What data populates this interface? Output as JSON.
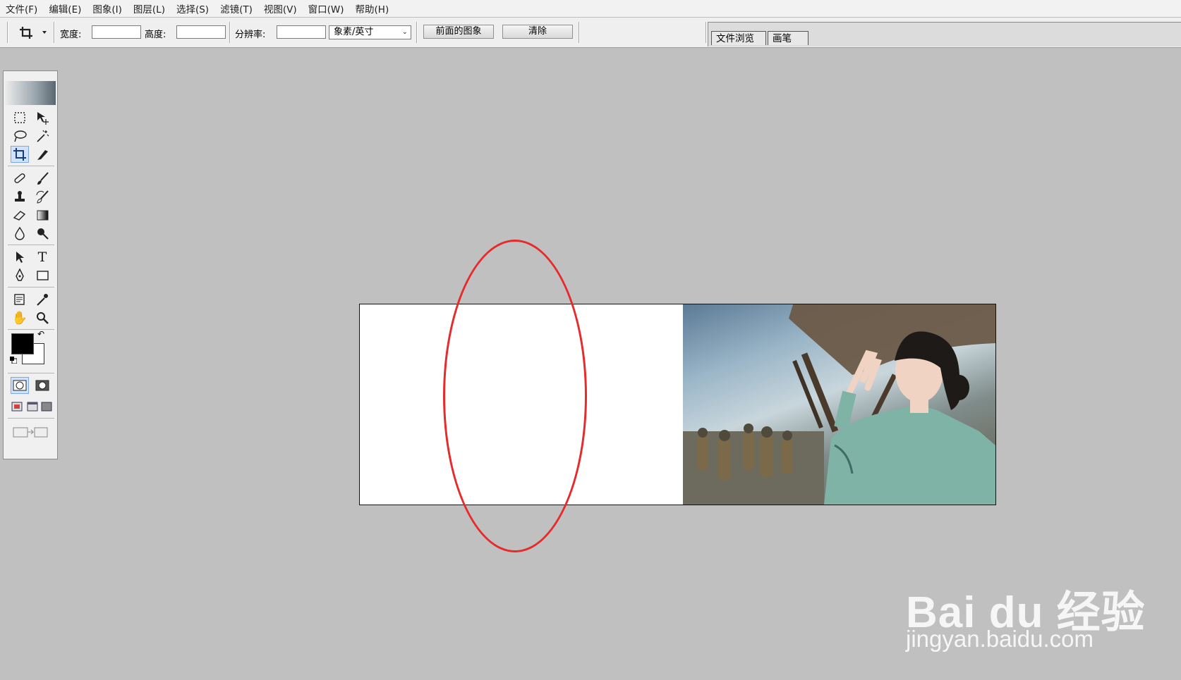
{
  "menu": [
    "文件(F)",
    "编辑(E)",
    "图象(I)",
    "图层(L)",
    "选择(S)",
    "滤镜(T)",
    "视图(V)",
    "窗口(W)",
    "帮助(H)"
  ],
  "options": {
    "width_label": "宽度:",
    "width_value": "",
    "height_label": "高度:",
    "height_value": "",
    "resolution_label": "分辨率:",
    "resolution_value": "",
    "unit_selected": "象素/英寸",
    "front_image_button": "前面的图象",
    "clear_button": "清除"
  },
  "palette_tabs": [
    "文件浏览",
    "画笔"
  ],
  "colors": {
    "foreground": "#000000",
    "background": "#ffffff",
    "annotation": "#e52b2b"
  },
  "watermark": {
    "logo": "Bai du 经验",
    "url": "jingyan.baidu.com"
  }
}
